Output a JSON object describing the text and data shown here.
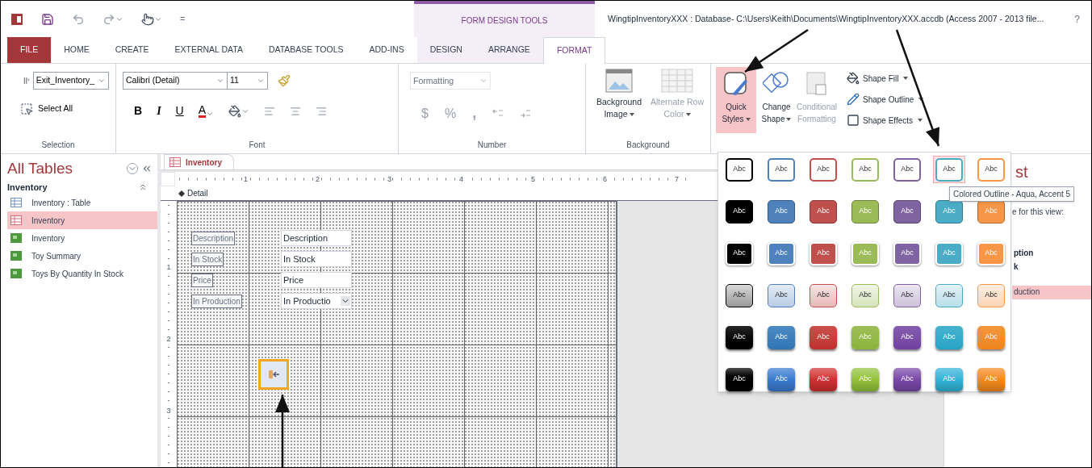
{
  "quick_access": {
    "customize": "="
  },
  "context_header": "FORM DESIGN TOOLS",
  "title": "WingtipInventoryXXX : Database- C:\\Users\\Keith\\Documents\\WingtipInventoryXXX.accdb (Access 2007 - 2013 file...",
  "help": "?",
  "tabs": [
    {
      "label": "FILE",
      "kind": "file",
      "selected": false
    },
    {
      "label": "HOME",
      "kind": "main",
      "selected": false
    },
    {
      "label": "CREATE",
      "kind": "main",
      "selected": false
    },
    {
      "label": "EXTERNAL DATA",
      "kind": "main",
      "selected": false
    },
    {
      "label": "DATABASE TOOLS",
      "kind": "main",
      "selected": false
    },
    {
      "label": "ADD-INS",
      "kind": "main",
      "selected": false
    },
    {
      "label": "DESIGN",
      "kind": "context",
      "selected": false
    },
    {
      "label": "ARRANGE",
      "kind": "context",
      "selected": false
    },
    {
      "label": "FORMAT",
      "kind": "context",
      "selected": true
    }
  ],
  "ribbon": {
    "selection": {
      "label": "Selection",
      "object_box": "Exit_Inventory_",
      "select_all": "Select All"
    },
    "font": {
      "label": "Font",
      "font_name": "Calibri (Detail)",
      "font_size": "11",
      "bold": "B",
      "italic": "I",
      "underline": "U",
      "font_color": "A"
    },
    "number": {
      "label": "Number",
      "format_box": {
        "placeholder": "Formatting"
      },
      "currency": "$",
      "percent": "%",
      "comma": ",",
      "disabled": true
    },
    "background": {
      "label": "Background",
      "buttons": [
        {
          "label": "Background Image",
          "disabled": false
        },
        {
          "label": "Alternate Row Color",
          "disabled": true
        }
      ]
    },
    "control_formatting": {
      "buttons": [
        {
          "label": "Quick Styles",
          "selected": true,
          "disabled": false
        },
        {
          "label": "Change Shape",
          "selected": false,
          "disabled": false
        },
        {
          "label": "Conditional Formatting",
          "selected": false,
          "disabled": true
        }
      ],
      "shape_menus": [
        "Shape Fill",
        "Shape Outline",
        "Shape Effects"
      ]
    }
  },
  "nav": {
    "title": "All Tables",
    "group": "Inventory",
    "items": [
      {
        "label": "Inventory : Table",
        "kind": "table",
        "selected": false
      },
      {
        "label": "Inventory",
        "kind": "form",
        "selected": true
      },
      {
        "label": "Inventory",
        "kind": "report",
        "selected": false
      },
      {
        "label": "Toy Summary",
        "kind": "report",
        "selected": false
      },
      {
        "label": "Toys By Quantity In Stock",
        "kind": "report",
        "selected": false
      }
    ]
  },
  "document": {
    "tab": "Inventory",
    "section": "Detail",
    "ruler": [
      "1",
      "2",
      "3",
      "4",
      "5",
      "6",
      "7"
    ],
    "vertical_ruler": [
      "1",
      "2",
      "3"
    ],
    "labels": [
      "Description",
      "In Stock",
      "Price",
      "In Production"
    ],
    "fields": [
      {
        "value": "Description",
        "kind": "text"
      },
      {
        "value": "In Stock",
        "kind": "text"
      },
      {
        "value": "Price",
        "kind": "text"
      },
      {
        "value": "In Productio",
        "kind": "combo"
      }
    ],
    "exit_button": {
      "selected": true
    }
  },
  "field_list": {
    "title": "st",
    "hint": "e for this view:",
    "fields": [
      {
        "label": "ption",
        "selected": false
      },
      {
        "label": "k",
        "selected": false
      },
      {
        "label": "duction",
        "selected": true
      }
    ]
  },
  "gallery": {
    "tooltip": "Colored Outline - Aqua, Accent 5",
    "rows": [
      {
        "kind": "outline",
        "swatches": [
          {
            "label": "Abc",
            "color": "#000000",
            "selected": false
          },
          {
            "label": "Abc",
            "color": "#4f81bd",
            "selected": false
          },
          {
            "label": "Abc",
            "color": "#c0504d",
            "selected": false
          },
          {
            "label": "Abc",
            "color": "#9bbb59",
            "selected": false
          },
          {
            "label": "Abc",
            "color": "#8064a2",
            "selected": false
          },
          {
            "label": "Abc",
            "color": "#4bacc6",
            "selected": true
          },
          {
            "label": "Abc",
            "color": "#f79646",
            "selected": false
          }
        ]
      },
      {
        "kind": "filled",
        "swatches": [
          {
            "label": "Abc",
            "color": "#000000",
            "selected": false
          },
          {
            "label": "Abc",
            "color": "#4f81bd",
            "selected": false
          },
          {
            "label": "Abc",
            "color": "#c0504d",
            "selected": false
          },
          {
            "label": "Abc",
            "color": "#9bbb59",
            "selected": false
          },
          {
            "label": "Abc",
            "color": "#8064a2",
            "selected": false
          },
          {
            "label": "Abc",
            "color": "#4bacc6",
            "selected": false
          },
          {
            "label": "Abc",
            "color": "#f79646",
            "selected": false
          }
        ]
      },
      {
        "kind": "flat",
        "swatches": [
          {
            "label": "Abc",
            "color": "#000000",
            "selected": false
          },
          {
            "label": "Abc",
            "color": "#4f81bd",
            "selected": false
          },
          {
            "label": "Abc",
            "color": "#c0504d",
            "selected": false
          },
          {
            "label": "Abc",
            "color": "#9bbb59",
            "selected": false
          },
          {
            "label": "Abc",
            "color": "#8064a2",
            "selected": false
          },
          {
            "label": "Abc",
            "color": "#4bacc6",
            "selected": false
          },
          {
            "label": "Abc",
            "color": "#f79646",
            "selected": false
          }
        ]
      },
      {
        "kind": "light",
        "swatches": [
          {
            "label": "Abc",
            "color": "#000000",
            "selected": false
          },
          {
            "label": "Abc",
            "color": "#4f81bd",
            "selected": false
          },
          {
            "label": "Abc",
            "color": "#c0504d",
            "selected": false
          },
          {
            "label": "Abc",
            "color": "#9bbb59",
            "selected": false
          },
          {
            "label": "Abc",
            "color": "#8064a2",
            "selected": false
          },
          {
            "label": "Abc",
            "color": "#4bacc6",
            "selected": false
          },
          {
            "label": "Abc",
            "color": "#f79646",
            "selected": false
          }
        ]
      },
      {
        "kind": "gradient",
        "swatches": [
          {
            "label": "Abc",
            "color": "#000000",
            "selected": false
          },
          {
            "label": "Abc",
            "color": "#2e75b6",
            "selected": false
          },
          {
            "label": "Abc",
            "color": "#c0302d",
            "selected": false
          },
          {
            "label": "Abc",
            "color": "#8cb33a",
            "selected": false
          },
          {
            "label": "Abc",
            "color": "#7040a0",
            "selected": false
          },
          {
            "label": "Abc",
            "color": "#25a4c6",
            "selected": false
          },
          {
            "label": "Abc",
            "color": "#f0841c",
            "selected": false
          }
        ]
      },
      {
        "kind": "glossy",
        "swatches": [
          {
            "label": "Abc",
            "color": "#000000",
            "selected": false
          },
          {
            "label": "Abc",
            "color": "#3a7bd0",
            "selected": false
          },
          {
            "label": "Abc",
            "color": "#d03030",
            "selected": false
          },
          {
            "label": "Abc",
            "color": "#93c23a",
            "selected": false
          },
          {
            "label": "Abc",
            "color": "#7a48a8",
            "selected": false
          },
          {
            "label": "Abc",
            "color": "#30b4d8",
            "selected": false
          },
          {
            "label": "Abc",
            "color": "#f58a1c",
            "selected": false
          }
        ]
      }
    ]
  }
}
